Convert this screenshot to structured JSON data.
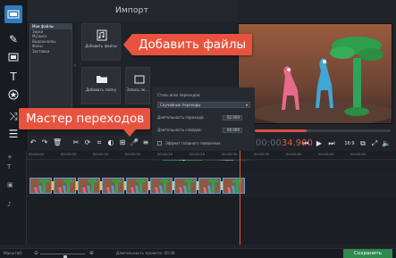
{
  "import_panel": {
    "title": "Импорт",
    "categories": [
      "Мои файлы",
      "Звуки",
      "Музыка",
      "Видеоклипы",
      "Фоны",
      "Заставки"
    ],
    "tiles": {
      "add_files": "Добавить файлы",
      "add_folder": "Добавить папку",
      "record_sound": "Запись эк..."
    }
  },
  "callouts": {
    "add_files": "Добавить файлы",
    "transition_wizard": "Мастер переходов"
  },
  "transition_dialog": {
    "style_label": "Стиль всех переходов:",
    "style_value": "Случайные переходы",
    "duration_label": "Длительность перехода:",
    "duration_value": "02.000",
    "slide_label": "Длительность слайдов:",
    "slide_value": "04.000",
    "effect_label": "Эффект плавного появления",
    "ok": "ОК",
    "cancel": "Отмена"
  },
  "player": {
    "timecode_dim": "00:00",
    "timecode": "34.900",
    "aspect": "16:9",
    "progress_fraction": 0.38
  },
  "ruler_ticks": [
    "00:00:00",
    "00:00:05",
    "00:00:10",
    "00:00:15",
    "00:00:20",
    "00:00:25",
    "00:00:30",
    "00:00:35",
    "00:00:40",
    "00:00:45",
    "00:00:50"
  ],
  "status": {
    "scale_label": "Масштаб:",
    "duration_label": "Длительность проекта: 00:36",
    "zoom_fraction": 0.55,
    "save": "Сохранить"
  },
  "colors": {
    "accent": "#e8533f",
    "active_tool": "#2e7cbf",
    "save": "#2f8a4e"
  }
}
